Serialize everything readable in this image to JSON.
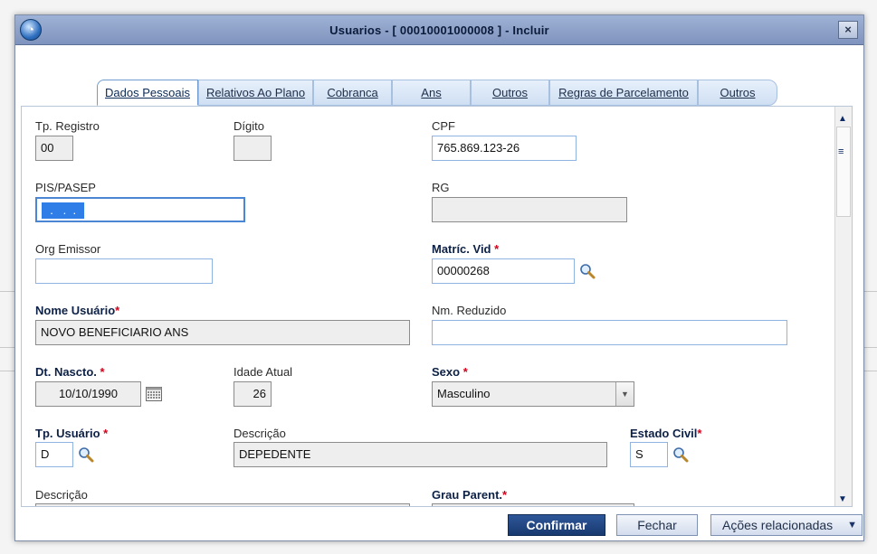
{
  "window": {
    "title": "Usuarios - [ 00010001000008 ] - Incluir",
    "close_glyph": "×",
    "app_icon": "totvs-globe-icon"
  },
  "tabs": [
    {
      "label": "Dados Pessoais",
      "active": true
    },
    {
      "label": "Relativos Ao Plano"
    },
    {
      "label": "Cobranca"
    },
    {
      "label": "Ans"
    },
    {
      "label": "Outros"
    },
    {
      "label": "Regras de Parcelamento"
    },
    {
      "label": "Outros"
    }
  ],
  "form": {
    "tp_registro": {
      "label": "Tp. Registro",
      "value": "00"
    },
    "digito": {
      "label": "Dígito",
      "value": ""
    },
    "cpf": {
      "label": "CPF",
      "value": "765.869.123-26"
    },
    "pis_pasep": {
      "label": "PIS/PASEP",
      "value": "  .   .  .  "
    },
    "rg": {
      "label": "RG",
      "value": ""
    },
    "org_emissor": {
      "label": "Org Emissor",
      "value": ""
    },
    "matric_vid": {
      "label": "Matríc. Vid",
      "required_mark": "*",
      "value": "00000268"
    },
    "nome_usuario": {
      "label": "Nome Usuário",
      "required_mark": "*",
      "value": "NOVO BENEFICIARIO ANS"
    },
    "nm_reduzido": {
      "label": "Nm. Reduzido",
      "value": ""
    },
    "dt_nascto": {
      "label": "Dt. Nascto.",
      "required_mark": "*",
      "value": "10/10/1990"
    },
    "idade_atual": {
      "label": "Idade Atual",
      "value": "26"
    },
    "sexo": {
      "label": "Sexo",
      "required_mark": "*",
      "value": "Masculino"
    },
    "tp_usuario": {
      "label": "Tp. Usuário",
      "required_mark": "*",
      "value": "D"
    },
    "descricao_tp": {
      "label": "Descrição",
      "value": "DEPEDENTE"
    },
    "estado_civil": {
      "label": "Estado Civil",
      "required_mark": "*",
      "value": "S"
    },
    "descricao_2": {
      "label": "Descrição"
    },
    "grau_parent": {
      "label": "Grau Parent.",
      "required_mark": "*"
    }
  },
  "footer": {
    "confirm_label": "Confirmar",
    "close_label": "Fechar",
    "actions_label": "Ações relacionadas"
  },
  "colors": {
    "titlebar": "#8ea3cc",
    "required_star": "#d0021b",
    "primary_button": "#1f4580",
    "input_border": "#8fb4e2"
  }
}
